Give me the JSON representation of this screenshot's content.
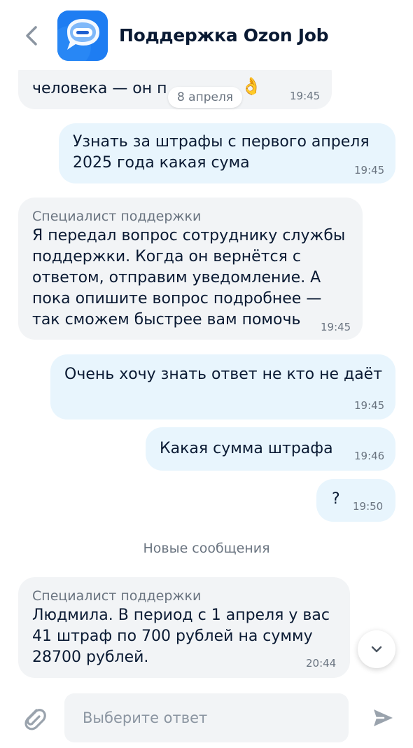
{
  "header": {
    "title": "Поддержка Ozon Job",
    "back_icon": "chevron-left-icon",
    "logo_icon": "chat-bubble-logo-icon",
    "logo_color": "#1e7df2"
  },
  "date_separator": "8 апреля",
  "messages": [
    {
      "direction": "in",
      "text": "человека — он п",
      "emoji": "👌",
      "time": "19:45"
    },
    {
      "direction": "out",
      "text": "Узнать за штрафы с первого апреля\n2025 года какая сума",
      "time": "19:45"
    },
    {
      "direction": "in",
      "sender": "Специалист поддержки",
      "text": "Я передал вопрос сотруднику службы\nподдержки. Когда он вернётся с\nответом, отправим уведомление. А\nпока опишите вопрос подробнее —\nтак сможем быстрее вам помочь",
      "time": "19:45"
    },
    {
      "direction": "out",
      "text": "Очень хочу знать ответ не кто не даёт",
      "time": "19:45"
    },
    {
      "direction": "out",
      "text": "Какая сумма штрафа",
      "time": "19:46"
    },
    {
      "direction": "out",
      "text": "?",
      "time": "19:50"
    }
  ],
  "new_messages_label": "Новые сообщения",
  "new_message": {
    "direction": "in",
    "sender": "Специалист поддержки",
    "text": "Людмила. В период с 1 апреля у вас\n41 штраф по 700 рублей на сумму\n28700 рублей.",
    "time": "20:44"
  },
  "input": {
    "placeholder": "Выберите ответ",
    "attach_icon": "paperclip-icon",
    "send_icon": "send-icon",
    "scroll_icon": "chevron-down-icon"
  },
  "colors": {
    "incoming_bubble": "#f2f4f6",
    "outgoing_bubble": "#e8f5fd",
    "secondary_text": "#6a7480",
    "primary_text": "#0a1a33"
  }
}
